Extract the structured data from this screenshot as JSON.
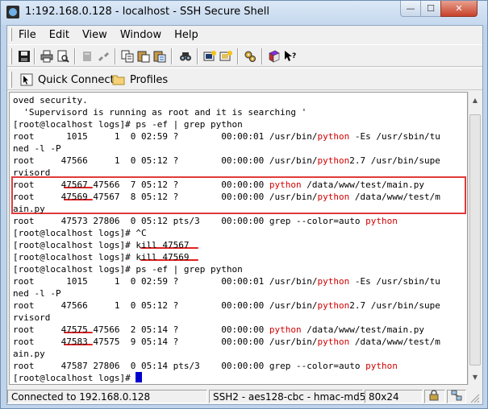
{
  "window": {
    "title": "1:192.168.0.128 - localhost - SSH Secure Shell",
    "controls": {
      "minimize": "—",
      "maximize": "☐",
      "close": "✕"
    }
  },
  "menu": [
    "File",
    "Edit",
    "View",
    "Window",
    "Help"
  ],
  "toolbar": {
    "icons": [
      "save-icon",
      "print-icon",
      "print-preview-icon",
      "disabled-icon",
      "disconnect-icon",
      "copy-icon",
      "paste-icon",
      "paste-special-icon",
      "find-icon",
      "new-terminal-icon",
      "new-file-transfer-icon",
      "settings-icon",
      "help-book-icon",
      "context-help-icon"
    ]
  },
  "quickbar": {
    "quick_connect": "Quick Connect",
    "profiles": "Profiles"
  },
  "terminal": {
    "lines": [
      [
        {
          "t": "oved security."
        }
      ],
      [
        {
          "t": "  'Supervisord is running as root and it is searching '"
        }
      ],
      [
        {
          "t": "[root@localhost logs]# ps -ef | grep python"
        }
      ],
      [
        {
          "t": "root      1015     1  0 02:59 ?        00:00:01 /usr/bin/"
        },
        {
          "t": "python",
          "c": "py"
        },
        {
          "t": " -Es /usr/sbin/tu"
        }
      ],
      [
        {
          "t": "ned -l -P"
        }
      ],
      [
        {
          "t": "root     47566     1  0 05:12 ?        00:00:00 /usr/bin/"
        },
        {
          "t": "python",
          "c": "py"
        },
        {
          "t": "2.7 /usr/bin/supe"
        }
      ],
      [
        {
          "t": "rvisord"
        }
      ],
      [
        {
          "t": "root     47567 47566  7 05:12 ?        00:00:00 "
        },
        {
          "t": "python",
          "c": "py"
        },
        {
          "t": " /data/www/test/main.py"
        }
      ],
      [
        {
          "t": "root     47569 47567  8 05:12 ?        00:00:00 /usr/bin/"
        },
        {
          "t": "python",
          "c": "py"
        },
        {
          "t": " /data/www/test/m"
        }
      ],
      [
        {
          "t": "ain.py"
        }
      ],
      [
        {
          "t": "root     47573 27806  0 05:12 pts/3    00:00:00 grep --color=auto "
        },
        {
          "t": "python",
          "c": "py"
        }
      ],
      [
        {
          "t": "[root@localhost logs]# ^C"
        }
      ],
      [
        {
          "t": "[root@localhost logs]# kill 47567"
        }
      ],
      [
        {
          "t": "[root@localhost logs]# kill 47569"
        }
      ],
      [
        {
          "t": "[root@localhost logs]# ps -ef | grep python"
        }
      ],
      [
        {
          "t": "root      1015     1  0 02:59 ?        00:00:01 /usr/bin/"
        },
        {
          "t": "python",
          "c": "py"
        },
        {
          "t": " -Es /usr/sbin/tu"
        }
      ],
      [
        {
          "t": "ned -l -P"
        }
      ],
      [
        {
          "t": "root     47566     1  0 05:12 ?        00:00:00 /usr/bin/"
        },
        {
          "t": "python",
          "c": "py"
        },
        {
          "t": "2.7 /usr/bin/supe"
        }
      ],
      [
        {
          "t": "rvisord"
        }
      ],
      [
        {
          "t": "root     47575 47566  2 05:14 ?        00:00:00 "
        },
        {
          "t": "python",
          "c": "py"
        },
        {
          "t": " /data/www/test/main.py"
        }
      ],
      [
        {
          "t": "root     47583 47575  9 05:14 ?        00:00:00 /usr/bin/"
        },
        {
          "t": "python",
          "c": "py"
        },
        {
          "t": " /data/www/test/m"
        }
      ],
      [
        {
          "t": "ain.py"
        }
      ],
      [
        {
          "t": "root     47587 27806  0 05:14 pts/3    00:00:00 grep --color=auto "
        },
        {
          "t": "python",
          "c": "py"
        }
      ],
      [
        {
          "t": "[root@localhost logs]# "
        },
        {
          "cursor": true
        }
      ]
    ]
  },
  "status": {
    "connection": "Connected to 192.168.0.128",
    "cipher": "SSH2 - aes128-cbc - hmac-md5",
    "size": "80x24"
  },
  "colors": {
    "python_keyword": "#d00000",
    "highlight": "#e23a3a",
    "cursor": "#0000cc"
  }
}
